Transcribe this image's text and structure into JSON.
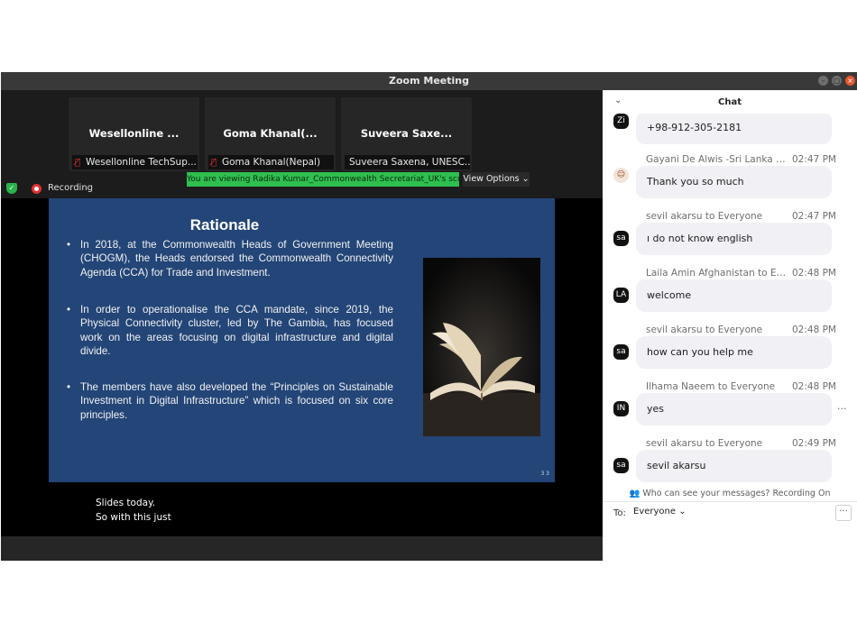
{
  "window": {
    "title": "Zoom Meeting"
  },
  "participants": [
    {
      "name": "Wesellonline ...",
      "label": "Wesellonline TechSup...",
      "muted": true
    },
    {
      "name": "Goma Khanal(...",
      "label": "Goma Khanal(Nepal)",
      "muted": true
    },
    {
      "name": "Suveera Saxe...",
      "label": "Suveera Saxena, UNESC...",
      "muted": false
    }
  ],
  "status": {
    "recording_label": "Recording",
    "viewing_banner": "You are viewing Radika Kumar_Commonwealth Secretariat_UK's screen",
    "view_options_label": "View Options"
  },
  "slide": {
    "title": "Rationale",
    "bullets": [
      "In 2018, at the Commonwealth Heads of Government Meeting (CHOGM), the Heads endorsed the Commonwealth Connectivity Agenda (CCA) for Trade and Investment.",
      "In order to operationalise the CCA mandate, since 2019, the Physical Connectivity cluster, led by The Gambia, has focused work on the areas focusing on digital infrastructure and digital divide.",
      "The members have also developed the “Principles on Sustainable Investment in Digital Infrastructure” which is focused on six core principles."
    ],
    "page_number": "3 3"
  },
  "captions": [
    "Slides today.",
    "So with this just"
  ],
  "chat": {
    "title": "Chat",
    "messages": [
      {
        "sender": "",
        "time": "",
        "text": "+98-912-305-2181",
        "avatar": "Zi"
      },
      {
        "sender": "Gayani De Alwis -Sri Lanka t...",
        "time": "02:47 PM",
        "text": "Thank you so much",
        "avatar": ""
      },
      {
        "sender": "sevil akarsu to Everyone",
        "time": "02:47 PM",
        "text": "ı do not know english",
        "avatar": "sa"
      },
      {
        "sender": "Laila Amin Afghanistan to Ev...",
        "time": "02:48 PM",
        "text": "welcome",
        "avatar": "LA"
      },
      {
        "sender": "sevil akarsu to Everyone",
        "time": "02:48 PM",
        "text": "how can you help me",
        "avatar": "sa"
      },
      {
        "sender": "Ilhama Naeem to Everyone",
        "time": "02:48 PM",
        "text": "yes",
        "avatar": "IN"
      },
      {
        "sender": "sevil akarsu to Everyone",
        "time": "02:49 PM",
        "text": "sevil akarsu",
        "avatar": "sa"
      }
    ],
    "privacy_note": "Who can see your messages? Recording On",
    "to_label": "To:",
    "recipient": "Everyone"
  },
  "colors": {
    "banner": "#2fbf4f",
    "slide_bg": "#234577",
    "record": "#e03131"
  }
}
